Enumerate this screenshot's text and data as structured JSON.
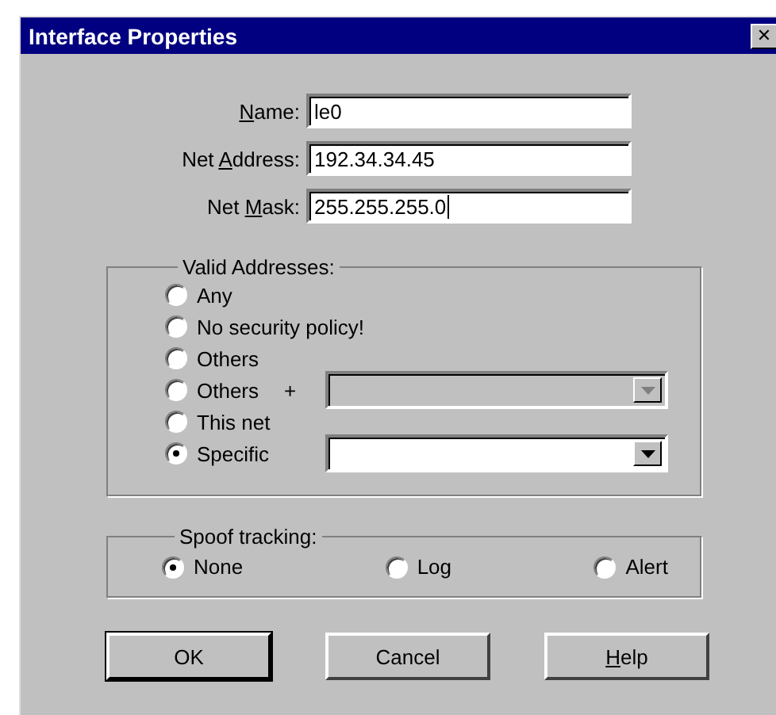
{
  "window": {
    "title": "Interface Properties",
    "close": "✕"
  },
  "fields": [
    {
      "label_key": "N",
      "label_after": "ame:",
      "value": "le0",
      "focused": false
    },
    {
      "label_before": "Net ",
      "label_key": "A",
      "label_after": "ddress:",
      "value": "192.34.34.45",
      "focused": false
    },
    {
      "label_before": "Net ",
      "label_key": "M",
      "label_after": "ask:",
      "value": "255.255.255.0",
      "focused": true
    }
  ],
  "valid_addresses": {
    "title": "Valid Addresses:",
    "options": [
      {
        "label": "Any",
        "selected": false
      },
      {
        "label": "No security policy!",
        "selected": false
      },
      {
        "label": "Others",
        "selected": false
      },
      {
        "label": "Others",
        "suffix": "+",
        "selected": false,
        "dropdown": {
          "disabled": true
        }
      },
      {
        "label": "This net",
        "selected": false
      },
      {
        "label": "Specific",
        "selected": true,
        "dropdown": {
          "disabled": false
        }
      }
    ]
  },
  "spoof_tracking": {
    "title": "Spoof tracking:",
    "options": [
      {
        "label": "None",
        "selected": true
      },
      {
        "label": "Log",
        "selected": false
      },
      {
        "label": "Alert",
        "selected": false
      }
    ]
  },
  "buttons": [
    {
      "label_after": "OK",
      "default": true
    },
    {
      "label_after": "Cancel",
      "default": false
    },
    {
      "label_key": "H",
      "label_after": "elp",
      "default": false
    }
  ]
}
